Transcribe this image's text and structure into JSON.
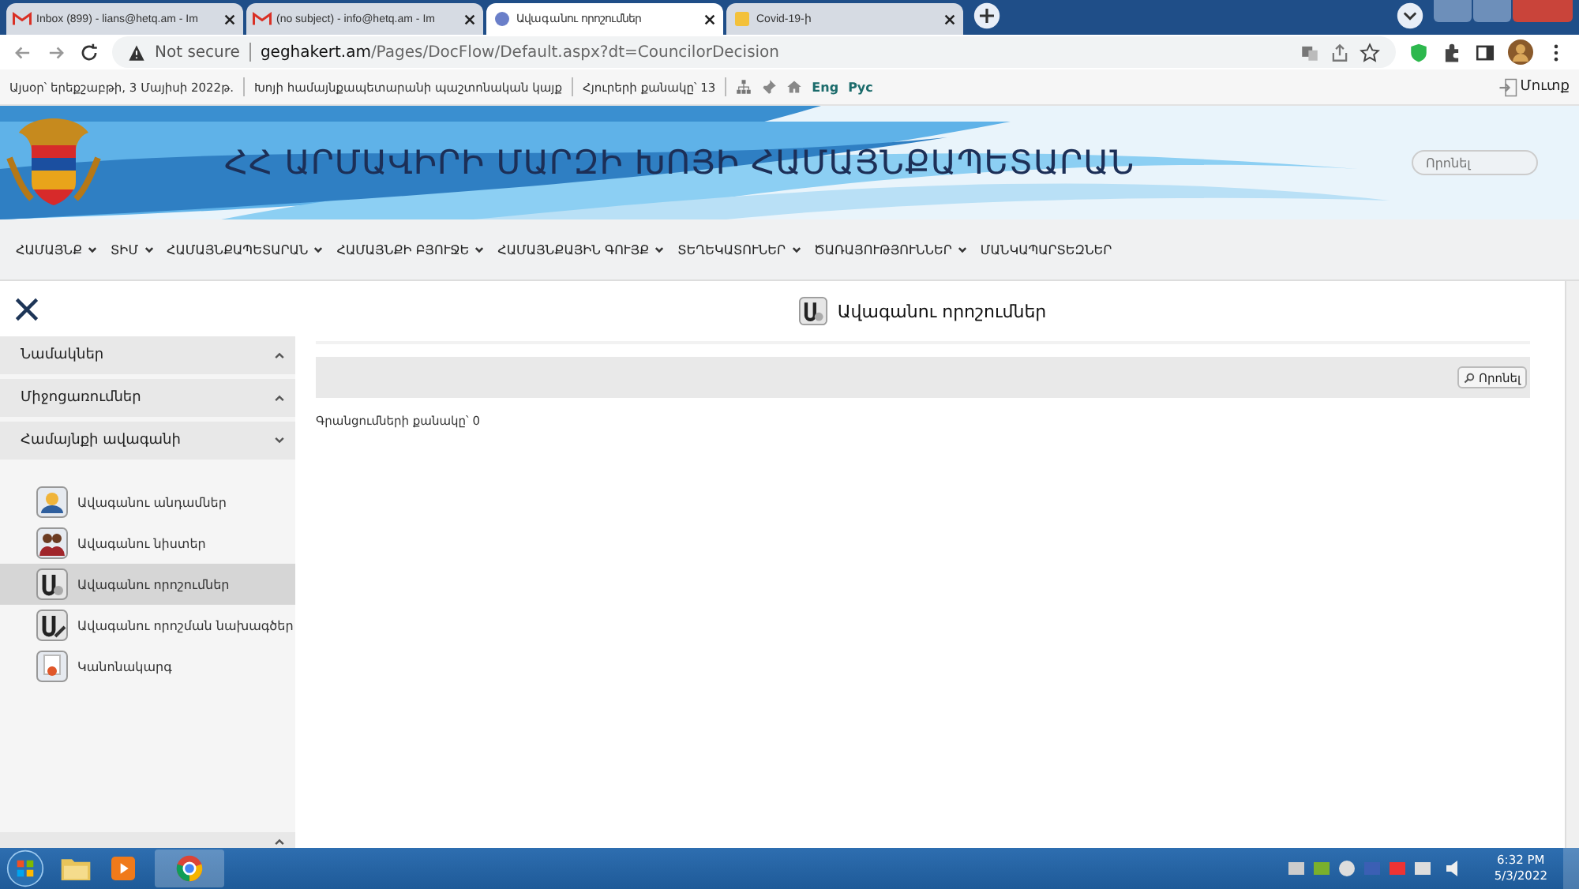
{
  "browser": {
    "tabs": [
      {
        "title": "Inbox (899) - lians@hetq.am - Im",
        "kind": "mail",
        "selected": false
      },
      {
        "title": "(no subject) - info@hetq.am - Im",
        "kind": "mail",
        "selected": false
      },
      {
        "title": "Ավագանու որոշումներ",
        "kind": "site",
        "selected": true
      },
      {
        "title": "Covid-19-ի",
        "kind": "doc",
        "selected": false
      }
    ],
    "address": {
      "warning": "Not secure",
      "host": "geghakert.am",
      "path": "/Pages/DocFlow/Default.aspx?dt=CouncilorDecision"
    }
  },
  "topbar": {
    "date": "Այսօր՝ երեքշաբթի, 3 Մայիսի 2022թ.",
    "org": "Խոյի համայնքապետարանի պաշտոնական կայք",
    "visitors": "Հյուրերի քանակը՝ 13",
    "languages": [
      "Eng",
      "Рус"
    ],
    "login": "Մուտք"
  },
  "banner": {
    "title": "ՀՀ ԱՐՄԱՎԻՐԻ ՄԱՐԶԻ ԽՈՅԻ ՀԱՄԱՅՆՔԱՊԵՏԱՐԱՆ",
    "search": {
      "placeholder": "Որոնել"
    }
  },
  "nav": [
    {
      "label": "ՀԱՄԱՅՆՔ",
      "dropdown": true
    },
    {
      "label": "ՏԻՄ",
      "dropdown": true
    },
    {
      "label": "ՀԱՄԱՅՆՔԱՊԵՏԱՐԱՆ",
      "dropdown": true
    },
    {
      "label": "ՀԱՄԱՅՆՔԻ ԲՅՈՒՋԵ",
      "dropdown": true
    },
    {
      "label": "ՀԱՄԱՅՆՔԱՅԻՆ ԳՈՒՅՔ",
      "dropdown": true
    },
    {
      "label": "ՏԵՂԵԿԱՏՈՒՆԵՐ",
      "dropdown": true
    },
    {
      "label": "ԾԱՌԱՅՈՒԹՅՈՒՆՆԵՐ",
      "dropdown": true
    },
    {
      "label": "ՄԱՆԿԱՊԱՐՏԵԶՆԵՐ",
      "dropdown": false
    }
  ],
  "sidebar": {
    "sections": [
      {
        "label": "Նամակներ",
        "expanded": false
      },
      {
        "label": "Միջոցառումներ",
        "expanded": false
      },
      {
        "label": "Համայնքի ավագանի",
        "expanded": true,
        "items": [
          {
            "label": "Ավագանու անդամներ",
            "kind": "members",
            "selected": false
          },
          {
            "label": "Ավագանու նիստեր",
            "kind": "sessions",
            "selected": false
          },
          {
            "label": "Ավագանու որոշումներ",
            "kind": "decisions",
            "selected": true
          },
          {
            "label": "Ավագանու որոշման նախագծեր",
            "kind": "drafts",
            "selected": false
          },
          {
            "label": "Կանոնակարգ",
            "kind": "rules",
            "selected": false
          }
        ]
      }
    ]
  },
  "content": {
    "title": "Ավագանու որոշումներ",
    "search_button": "Որոնել",
    "count": "Գրանցումների քանակը՝ 0"
  },
  "taskbar": {
    "time": "6:32 PM",
    "date": "5/3/2022"
  }
}
